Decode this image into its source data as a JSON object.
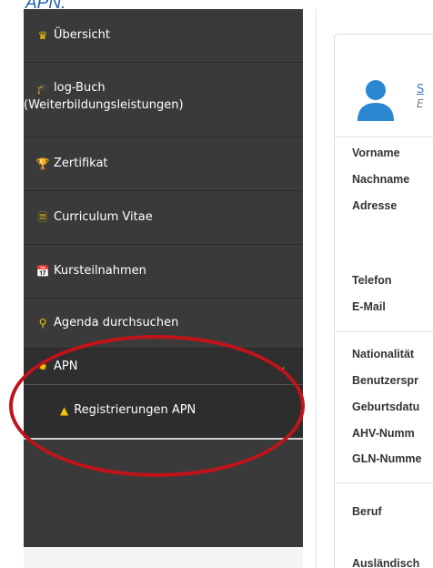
{
  "caption": "APN.",
  "sidebar": {
    "items": [
      {
        "label": "Übersicht",
        "icon": "user-icon"
      },
      {
        "label": "log-Buch",
        "label2": "(Weiterbildungsleistungen)",
        "icon": "graduation-cap-icon"
      },
      {
        "label": "Zertifikat",
        "icon": "trophy-icon"
      },
      {
        "label": "Curriculum Vitae",
        "icon": "document-icon"
      },
      {
        "label": "Kursteilnahmen",
        "icon": "calendar-icon"
      },
      {
        "label": "Agenda durchsuchen",
        "icon": "search-icon"
      },
      {
        "label": "APN",
        "icon": "starburst-icon"
      }
    ],
    "submenu": [
      {
        "label": "Registrierungen APN",
        "icon": "sitemap-icon"
      }
    ]
  },
  "profile": {
    "link_fragment": "S",
    "subtitle_fragment": "E",
    "fields_personal": [
      "Vorname",
      "Nachname",
      "Adresse",
      "Telefon",
      "E-Mail"
    ],
    "fields_details": [
      "Nationalität",
      "Benutzerspr",
      "Geburtsdatu",
      "AHV-Numm",
      "GLN-Numme"
    ],
    "fields_job": [
      "Beruf",
      "Ausländisch"
    ]
  },
  "colors": {
    "accent": "#f5c400",
    "sidebar": "#3a3a3a",
    "annotation": "#c0141a",
    "avatar": "#2a87d0"
  }
}
